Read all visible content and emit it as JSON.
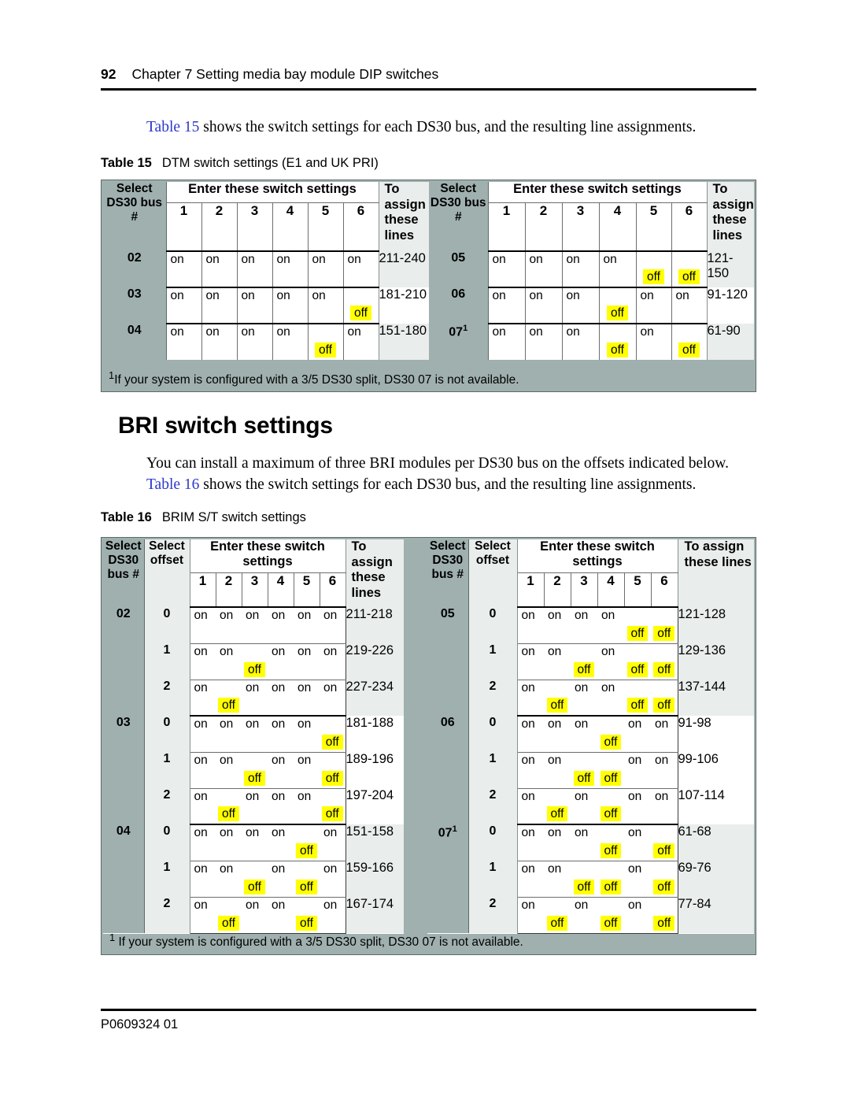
{
  "page": {
    "number": "92",
    "chapter": "Chapter 7  Setting media bay module DIP switches",
    "footer": "P0609324  01"
  },
  "intro_paragraph": {
    "xref": "Table 15",
    "rest": " shows the switch settings for each DS30 bus, and the resulting line assignments."
  },
  "table15": {
    "caption_label": "Table 15",
    "caption_text": "DTM switch settings (E1 and UK PRI)",
    "footnote_marker": "1",
    "footnote": "If your system is configured with a 3/5 DS30 split, DS30 07 is not available.",
    "left": {
      "header": {
        "bus": "Select DS30 bus #",
        "switch_group": "Enter these switch settings",
        "switch_numbers": [
          "1",
          "2",
          "3",
          "4",
          "5",
          "6"
        ],
        "lines": "To assign these lines"
      },
      "rows": [
        {
          "bus": "02",
          "switches": [
            "on",
            "on",
            "on",
            "on",
            "on",
            "on"
          ],
          "lines": "211-240"
        },
        {
          "bus": "03",
          "switches": [
            "on",
            "on",
            "on",
            "on",
            "on",
            "off"
          ],
          "lines": "181-210"
        },
        {
          "bus": "04",
          "switches": [
            "on",
            "on",
            "on",
            "on",
            "off",
            "on"
          ],
          "lines": "151-180"
        }
      ]
    },
    "right": {
      "header": {
        "bus": "Select DS30 bus #",
        "switch_group": "Enter these switch settings",
        "switch_numbers": [
          "1",
          "2",
          "3",
          "4",
          "5",
          "6"
        ],
        "lines": "To assign these lines"
      },
      "rows": [
        {
          "bus": "05",
          "switches": [
            "on",
            "on",
            "on",
            "on",
            "off",
            "off"
          ],
          "lines": "121-150"
        },
        {
          "bus": "06",
          "switches": [
            "on",
            "on",
            "on",
            "off",
            "on",
            "on"
          ],
          "lines": "91-120"
        },
        {
          "bus": "07",
          "bus_sup": "1",
          "switches": [
            "on",
            "on",
            "on",
            "off",
            "on",
            "off"
          ],
          "lines": "61-90"
        }
      ]
    }
  },
  "bri_heading": "BRI switch settings",
  "bri_paragraph": {
    "line1": "You can install a maximum of three BRI modules per DS30 bus on the offsets indicated below.",
    "xref": "Table 16",
    "rest": " shows the switch settings for each DS30 bus, and the resulting line assignments."
  },
  "table16": {
    "caption_label": "Table 16",
    "caption_text": "BRIM S/T switch settings",
    "footnote_marker": "1",
    "footnote": "If your system is configured with a 3/5 DS30 split, DS30 07 is not available.",
    "left": {
      "header": {
        "bus": "Select DS30 bus #",
        "offset": "Select offset",
        "switch_group": "Enter these switch settings",
        "switch_numbers": [
          "1",
          "2",
          "3",
          "4",
          "5",
          "6"
        ],
        "lines": "To assign these lines"
      },
      "groups": [
        {
          "bus": "02",
          "rows": [
            {
              "offset": "0",
              "switches": [
                "on",
                "on",
                "on",
                "on",
                "on",
                "on"
              ],
              "lines": "211-218"
            },
            {
              "offset": "1",
              "switches": [
                "on",
                "on",
                "off",
                "on",
                "on",
                "on"
              ],
              "lines": "219-226"
            },
            {
              "offset": "2",
              "switches": [
                "on",
                "off",
                "on",
                "on",
                "on",
                "on"
              ],
              "lines": "227-234"
            }
          ]
        },
        {
          "bus": "03",
          "rows": [
            {
              "offset": "0",
              "switches": [
                "on",
                "on",
                "on",
                "on",
                "on",
                "off"
              ],
              "lines": "181-188"
            },
            {
              "offset": "1",
              "switches": [
                "on",
                "on",
                "off",
                "on",
                "on",
                "off"
              ],
              "lines": "189-196"
            },
            {
              "offset": "2",
              "switches": [
                "on",
                "off",
                "on",
                "on",
                "on",
                "off"
              ],
              "lines": "197-204"
            }
          ]
        },
        {
          "bus": "04",
          "rows": [
            {
              "offset": "0",
              "switches": [
                "on",
                "on",
                "on",
                "on",
                "off",
                "on"
              ],
              "lines": "151-158"
            },
            {
              "offset": "1",
              "switches": [
                "on",
                "on",
                "off",
                "on",
                "off",
                "on"
              ],
              "lines": "159-166"
            },
            {
              "offset": "2",
              "switches": [
                "on",
                "off",
                "on",
                "on",
                "off",
                "on"
              ],
              "lines": "167-174"
            }
          ]
        }
      ]
    },
    "right": {
      "header": {
        "bus": "Select DS30 bus #",
        "offset": "Select offset",
        "switch_group": "Enter these switch settings",
        "switch_numbers": [
          "1",
          "2",
          "3",
          "4",
          "5",
          "6"
        ],
        "lines": "To assign these lines"
      },
      "groups": [
        {
          "bus": "05",
          "rows": [
            {
              "offset": "0",
              "switches": [
                "on",
                "on",
                "on",
                "on",
                "off",
                "off"
              ],
              "lines": "121-128"
            },
            {
              "offset": "1",
              "switches": [
                "on",
                "on",
                "off",
                "on",
                "off",
                "off"
              ],
              "lines": "129-136"
            },
            {
              "offset": "2",
              "switches": [
                "on",
                "off",
                "on",
                "on",
                "off",
                "off"
              ],
              "lines": "137-144"
            }
          ]
        },
        {
          "bus": "06",
          "rows": [
            {
              "offset": "0",
              "switches": [
                "on",
                "on",
                "on",
                "off",
                "on",
                "on"
              ],
              "lines": "91-98"
            },
            {
              "offset": "1",
              "switches": [
                "on",
                "on",
                "off",
                "off",
                "on",
                "on"
              ],
              "lines": "99-106"
            },
            {
              "offset": "2",
              "switches": [
                "on",
                "off",
                "on",
                "off",
                "on",
                "on"
              ],
              "lines": "107-114"
            }
          ]
        },
        {
          "bus": "07",
          "bus_sup": "1",
          "rows": [
            {
              "offset": "0",
              "switches": [
                "on",
                "on",
                "on",
                "off",
                "on",
                "off"
              ],
              "lines": "61-68"
            },
            {
              "offset": "1",
              "switches": [
                "on",
                "on",
                "off",
                "off",
                "on",
                "off"
              ],
              "lines": "69-76"
            },
            {
              "offset": "2",
              "switches": [
                "on",
                "off",
                "on",
                "off",
                "on",
                "off"
              ],
              "lines": "77-84"
            }
          ]
        }
      ]
    }
  },
  "colors": {
    "bus_header_bg": "#9FB0AE",
    "offset_bg": "#E9EDEC",
    "highlight": "#ffff00",
    "xref_link": "#2b38c8"
  }
}
